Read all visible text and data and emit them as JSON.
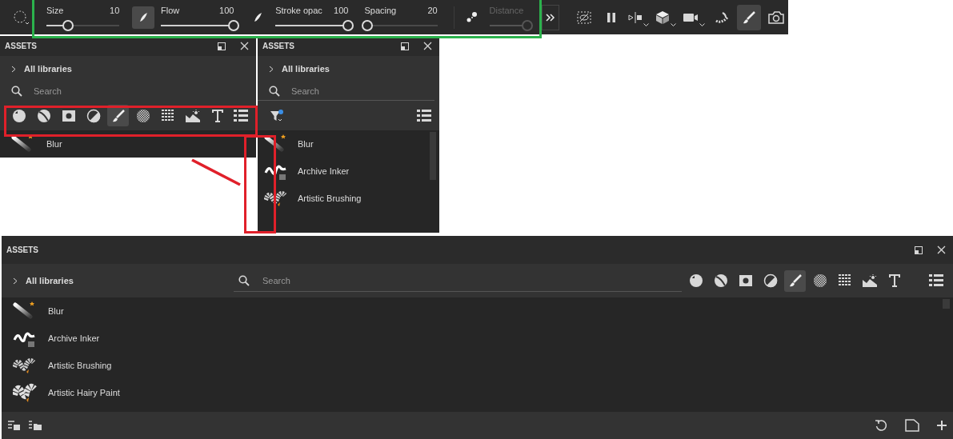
{
  "toolbar": {
    "controls": [
      {
        "kind": "slider",
        "label": "Size",
        "value": "10",
        "level": 0.3,
        "disabled": false
      },
      {
        "kind": "tip",
        "selected": true
      },
      {
        "kind": "slider",
        "label": "Flow",
        "value": "100",
        "level": 1,
        "disabled": false
      },
      {
        "kind": "tip",
        "selected": false
      },
      {
        "kind": "slider",
        "label": "Stroke opac",
        "value": "100",
        "level": 1,
        "disabled": false
      },
      {
        "kind": "slider",
        "label": "Spacing",
        "value": "20",
        "level": 0.04,
        "disabled": false
      },
      {
        "kind": "scatter",
        "selected": false
      },
      {
        "kind": "slider",
        "label": "Distance",
        "level": 1,
        "disabled": true
      }
    ],
    "tools": [
      {
        "menu": false,
        "selected": false
      },
      {
        "menu": false,
        "selected": false
      },
      {
        "menu": true,
        "selected": false
      },
      {
        "menu": true,
        "selected": false
      },
      {
        "menu": true,
        "selected": false
      },
      {
        "menu": false,
        "selected": false
      },
      {
        "menu": false,
        "selected": true
      },
      {
        "menu": false,
        "selected": false
      }
    ]
  },
  "panels": [
    {
      "kind": "compact",
      "title": "ASSETS",
      "library": "All libraries",
      "search": {
        "placeholder": "Search"
      },
      "types": [
        {
          "selected": false
        },
        {
          "selected": false
        },
        {
          "selected": false
        },
        {
          "selected": false
        },
        {
          "selected": true
        },
        {
          "selected": false
        },
        {
          "selected": false
        },
        {
          "selected": false
        },
        {
          "selected": false
        }
      ],
      "items": [
        {
          "kind": "blur",
          "name": "Blur"
        }
      ]
    },
    {
      "kind": "narrow",
      "title": "ASSETS",
      "library": "All libraries",
      "search": {
        "placeholder": "Search"
      },
      "items": [
        {
          "kind": "blur",
          "name": "Blur"
        },
        {
          "kind": "inker",
          "name": "Archive Inker"
        },
        {
          "kind": "bristle",
          "name": "Artistic Brushing"
        }
      ]
    },
    {
      "kind": "wide",
      "title": "ASSETS",
      "library": "All libraries",
      "search": {
        "placeholder": "Search"
      },
      "types": [
        {
          "selected": false
        },
        {
          "selected": false
        },
        {
          "selected": false
        },
        {
          "selected": false
        },
        {
          "selected": true
        },
        {
          "selected": false
        },
        {
          "selected": false
        },
        {
          "selected": false
        },
        {
          "selected": false
        }
      ],
      "items": [
        {
          "kind": "blur",
          "name": "Blur"
        },
        {
          "kind": "inker",
          "name": "Archive Inker"
        },
        {
          "kind": "bristle",
          "name": "Artistic Brushing"
        },
        {
          "kind": "hairy",
          "name": "Artistic Hairy Paint"
        }
      ]
    }
  ],
  "annotations": [
    {
      "kind": "box",
      "color": "#2bb24c"
    },
    {
      "kind": "box",
      "color": "#e0202a"
    },
    {
      "kind": "box",
      "color": "#e0202a"
    },
    {
      "kind": "line",
      "color": "#e0202a"
    }
  ]
}
